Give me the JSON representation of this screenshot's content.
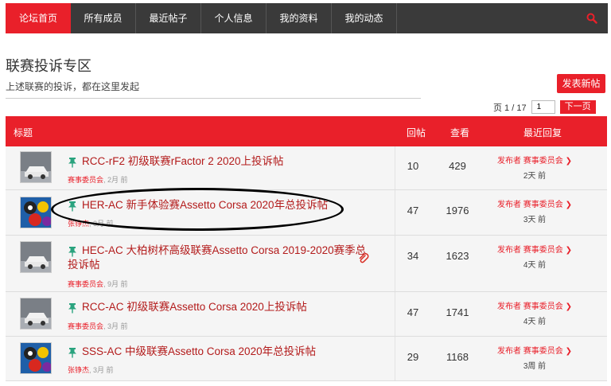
{
  "nav": {
    "items": [
      "论坛首页",
      "所有成员",
      "最近帖子",
      "个人信息",
      "我的资料",
      "我的动态"
    ],
    "search_icon": "search-icon",
    "active_color": "#e9202a",
    "bar_color": "#3a3a3a"
  },
  "page": {
    "title": "联赛投诉专区",
    "description": "上述联赛的投诉，都在这里发起",
    "post_button": "发表新帖"
  },
  "pager": {
    "label": "页 1 / 17",
    "current": "1",
    "next": "下一页"
  },
  "table": {
    "headers": {
      "title": "标题",
      "replies": "回帖",
      "views": "查看",
      "last_reply": "最近回复"
    },
    "rows": [
      {
        "thumb": "car",
        "title": "RCC-rF2 初级联赛rFactor 2 2020上投诉帖",
        "author": "赛事委员会",
        "age": "2月 前",
        "replies": "10",
        "views": "429",
        "last_by": "发布者 赛事委员会",
        "last_time": "2天 前"
      },
      {
        "thumb": "billiards",
        "title": "HER-AC 新手体验赛Assetto Corsa 2020年总投诉帖",
        "author": "张铮杰",
        "age": "3月 前",
        "replies": "47",
        "views": "1976",
        "last_by": "发布者 赛事委员会",
        "last_time": "3天 前"
      },
      {
        "thumb": "car",
        "title": "HEC-AC 大柏树杯高级联赛Assetto Corsa 2019-2020赛季总",
        "title_line2": "投诉帖",
        "author": "赛事委员会",
        "age": "9月 前",
        "replies": "34",
        "views": "1623",
        "last_by": "发布者 赛事委员会",
        "last_time": "4天 前"
      },
      {
        "thumb": "car",
        "title": "RCC-AC 初级联赛Assetto Corsa 2020上投诉帖",
        "author": "赛事委员会",
        "age": "3月 前",
        "replies": "47",
        "views": "1741",
        "last_by": "发布者 赛事委员会",
        "last_time": "4天 前"
      },
      {
        "thumb": "billiards",
        "title": "SSS-AC 中级联赛Assetto Corsa 2020年总投诉帖",
        "author": "张铮杰",
        "age": "3月 前",
        "replies": "29",
        "views": "1168",
        "last_by": "发布者 赛事委员会",
        "last_time": "3周 前"
      }
    ]
  }
}
